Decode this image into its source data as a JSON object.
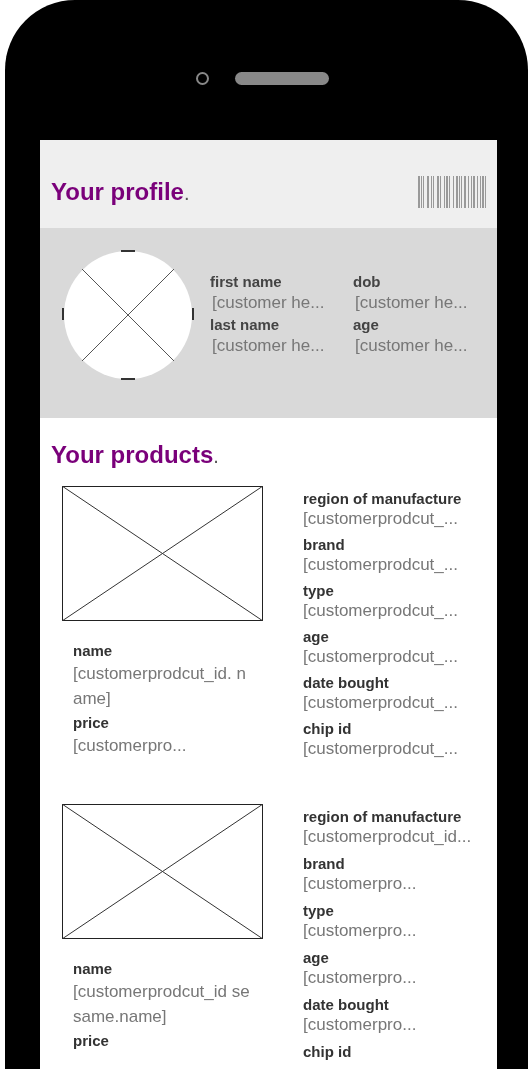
{
  "profile": {
    "title": "Your profile",
    "title_mark": ".",
    "fields": [
      {
        "label": "first name",
        "value": "[customer he..."
      },
      {
        "label": "dob",
        "value": "[customer he..."
      },
      {
        "label": "last name",
        "value": "[customer he..."
      },
      {
        "label": "age",
        "value": "[customer he..."
      }
    ]
  },
  "products": {
    "title": "Your products",
    "title_mark": ".",
    "items": [
      {
        "name_label": "name",
        "name_value": "[customerprodcut_id. name]",
        "price_label": "price",
        "price_value": "[customerpro...",
        "details": [
          {
            "label": "region of manufacture",
            "value": "[customerprodcut_..."
          },
          {
            "label": "brand",
            "value": "[customerprodcut_..."
          },
          {
            "label": "type",
            "value": "[customerprodcut_..."
          },
          {
            "label": "age",
            "value": "[customerprodcut_..."
          },
          {
            "label": "date bought",
            "value": "[customerprodcut_..."
          },
          {
            "label": "chip id",
            "value": "[customerprodcut_..."
          }
        ]
      },
      {
        "name_label": "name",
        "name_value": "[customerprodcut_id sesame.name]",
        "price_label": "price",
        "details": [
          {
            "label": "region of manufacture",
            "value": "[customerprodcut_id..."
          },
          {
            "label": "brand",
            "value": "[customerpro..."
          },
          {
            "label": "type",
            "value": "[customerpro..."
          },
          {
            "label": "age",
            "value": "[customerpro..."
          },
          {
            "label": "date bought",
            "value": "[customerpro..."
          },
          {
            "label": "chip id"
          }
        ]
      }
    ]
  }
}
